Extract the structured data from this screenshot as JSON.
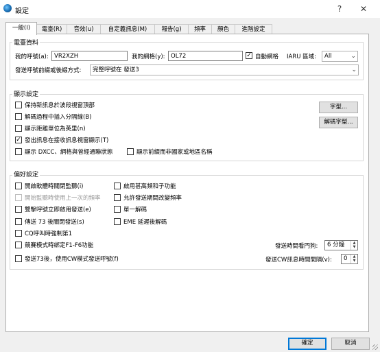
{
  "window": {
    "title": "設定",
    "help_label": "?",
    "close_label": "✕",
    "icon": "app-globe-icon"
  },
  "tabs": [
    {
      "label": "一般(I)",
      "active": true
    },
    {
      "label": "電臺(R)",
      "active": false
    },
    {
      "label": "音效(u)",
      "active": false
    },
    {
      "label": "自定義訊息(M)",
      "active": false
    },
    {
      "label": "報告(g)",
      "active": false
    },
    {
      "label": "頻率",
      "active": false
    },
    {
      "label": "顏色",
      "active": false
    },
    {
      "label": "進階設定",
      "active": false
    }
  ],
  "station": {
    "title": "電臺資料",
    "callsign_label": "我的呼號(a):",
    "callsign_value": "VR2XZH",
    "grid_label": "我的網格(y):",
    "grid_value": "OL72",
    "auto_grid_label": "自動網格",
    "auto_grid_checked": true,
    "iaru_label": "IARU 區域:",
    "iaru_value": "All",
    "prefix_label": "發送呼號前綴或後綴方式:",
    "prefix_value": "完整呼號在 發送3"
  },
  "display": {
    "title": "顯示設定",
    "options": [
      {
        "label": "保持新訊息於波段視窗頂部",
        "checked": false
      },
      {
        "label": "解碼過程中插入分隔線(B)",
        "checked": false
      },
      {
        "label": "顯示距離單位為英里(n)",
        "checked": false
      },
      {
        "label": "發出訊息在接收訊息視窗顯示(T)",
        "checked": true
      },
      {
        "label": "顯示 DXCC、網格與曾經通聯狀態",
        "checked": false
      },
      {
        "label": "顯示前綴而非國家或地區名稱",
        "checked": false
      }
    ],
    "font_button": "字型...",
    "decode_font_button": "解碼字型..."
  },
  "prefs": {
    "title": "偏好設定",
    "left_options": [
      {
        "label": "開啟軟體時關閉監聽(i)",
        "checked": false,
        "disabled": false
      },
      {
        "label": "開始監聽時使用上一次的頻率",
        "checked": false,
        "disabled": true
      },
      {
        "label": "雙擊呼號立即啟用發送(e)",
        "checked": false,
        "disabled": false
      },
      {
        "label": "傳送 73 後關閉發送(s)",
        "checked": false,
        "disabled": false
      },
      {
        "label": "CQ呼叫時強制第1",
        "checked": false,
        "disabled": false
      },
      {
        "label": "競賽模式時綁定F1-F6功能",
        "checked": false,
        "disabled": false
      },
      {
        "label": "發送73後，使用CW模式發送呼號(f)",
        "checked": false,
        "disabled": false
      }
    ],
    "right_options": [
      {
        "label": "啟用甚高頻和子功能",
        "checked": false
      },
      {
        "label": "允許發送期間改變頻率",
        "checked": false
      },
      {
        "label": "單一解碼",
        "checked": false
      },
      {
        "label": "EME 延遲後解碼",
        "checked": false
      }
    ],
    "watchdog_label": "發送時間看門狗:",
    "watchdog_value": "6 分鐘",
    "cw_interval_label": "發送CW訊息時間間隔(v):",
    "cw_interval_value": "0"
  },
  "footer": {
    "ok_label": "確定",
    "cancel_label": "取消"
  },
  "colors": {
    "accent": "#0078d7",
    "panel_bg": "#ffffff",
    "dialog_bg": "#f0f0f0"
  }
}
